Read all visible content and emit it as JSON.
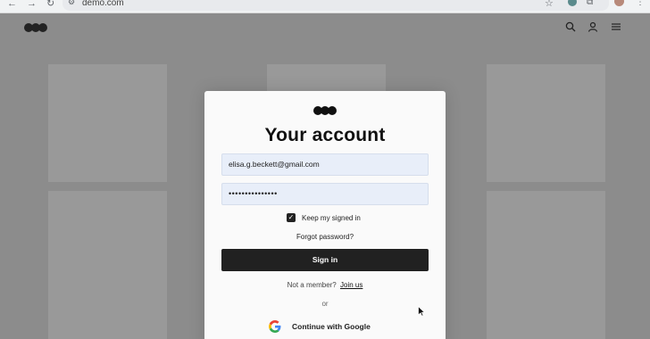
{
  "browser": {
    "url": "demo.com"
  },
  "login": {
    "title": "Your account",
    "email_value": "elisa.g.beckett@gmail.com",
    "password_value": "•••••••••••••••",
    "keep_signed_in_label": "Keep my signed in",
    "keep_signed_in_checked": true,
    "forgot_label": "Forgot password?",
    "signin_label": "Sign in",
    "not_member_text": "Not a member?",
    "join_label": "Join us",
    "or_text": "or",
    "google_label": "Continue with Google"
  }
}
